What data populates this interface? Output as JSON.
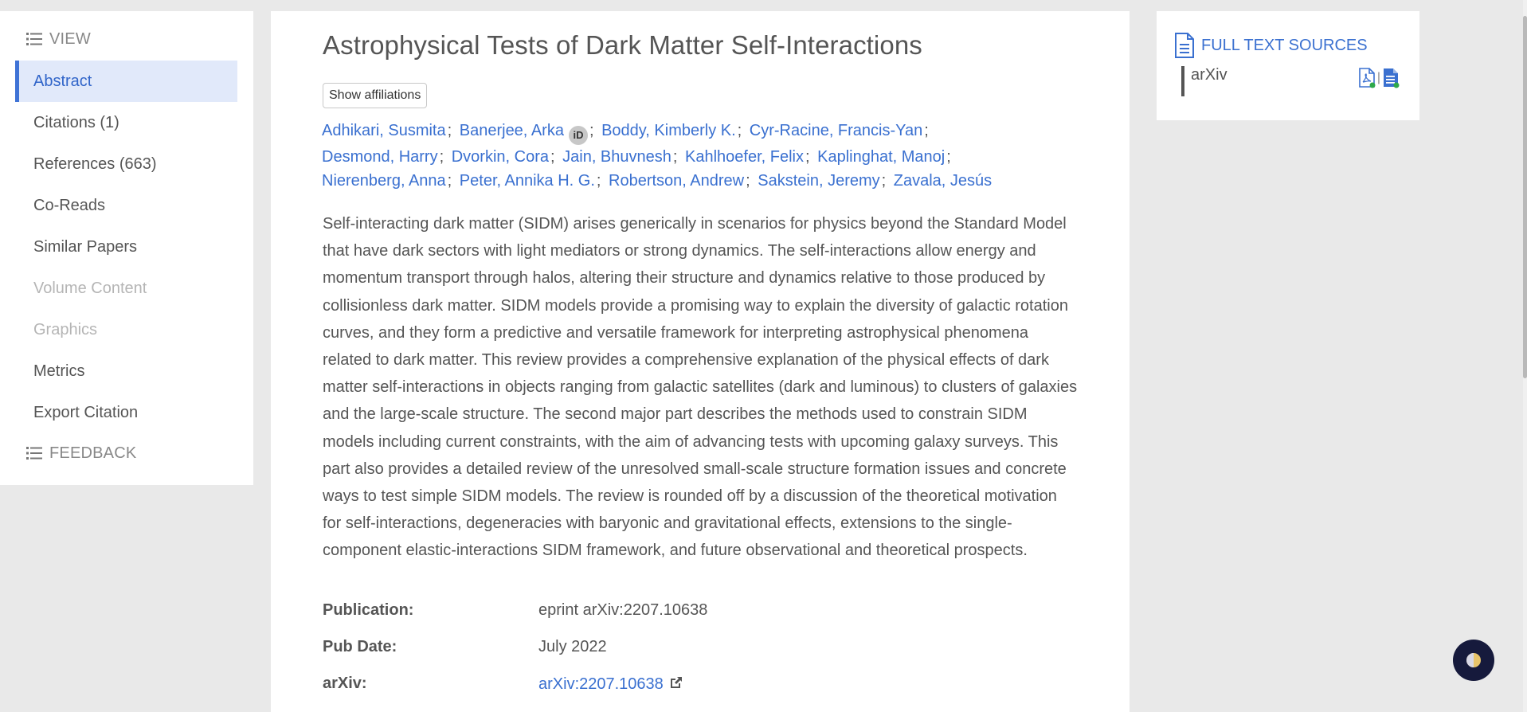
{
  "sidebar": {
    "view_label": "VIEW",
    "items": [
      {
        "label": "Abstract"
      },
      {
        "label": "Citations (1)"
      },
      {
        "label": "References (663)"
      },
      {
        "label": "Co-Reads"
      },
      {
        "label": "Similar Papers"
      },
      {
        "label": "Volume Content"
      },
      {
        "label": "Graphics"
      },
      {
        "label": "Metrics"
      },
      {
        "label": "Export Citation"
      }
    ],
    "feedback_label": "FEEDBACK"
  },
  "paper": {
    "title": "Astrophysical Tests of Dark Matter Self-Interactions",
    "show_affiliations": "Show affiliations",
    "authors": [
      "Adhikari, Susmita",
      "Banerjee, Arka",
      "Boddy, Kimberly K.",
      "Cyr-Racine, Francis-Yan",
      "Desmond, Harry",
      "Dvorkin, Cora",
      "Jain, Bhuvnesh",
      "Kahlhoefer, Felix",
      "Kaplinghat, Manoj",
      "Nierenberg, Anna",
      "Peter, Annika H. G.",
      "Robertson, Andrew",
      "Sakstein, Jeremy",
      "Zavala, Jesús"
    ],
    "orcid_label": "iD",
    "separator": ";",
    "abstract": "Self-interacting dark matter (SIDM) arises generically in scenarios for physics beyond the Standard Model that have dark sectors with light mediators or strong dynamics. The self-interactions allow energy and momentum transport through halos, altering their structure and dynamics relative to those produced by collisionless dark matter. SIDM models provide a promising way to explain the diversity of galactic rotation curves, and they form a predictive and versatile framework for interpreting astrophysical phenomena related to dark matter. This review provides a comprehensive explanation of the physical effects of dark matter self-interactions in objects ranging from galactic satellites (dark and luminous) to clusters of galaxies and the large-scale structure. The second major part describes the methods used to constrain SIDM models including current constraints, with the aim of advancing tests with upcoming galaxy surveys. This part also provides a detailed review of the unresolved small-scale structure formation issues and concrete ways to test simple SIDM models. The review is rounded off by a discussion of the theoretical motivation for self-interactions, degeneracies with baryonic and gravitational effects, extensions to the single-component elastic-interactions SIDM framework, and future observational and theoretical prospects.",
    "meta": {
      "publication_label": "Publication:",
      "publication_value": "eprint arXiv:2207.10638",
      "pubdate_label": "Pub Date:",
      "pubdate_value": "July 2022",
      "arxiv_label": "arXiv:",
      "arxiv_value": "arXiv:2207.10638"
    }
  },
  "full_text": {
    "title": "FULL TEXT SOURCES",
    "source": "arXiv",
    "pipe": "|",
    "icons": [
      "pdf-icon",
      "html-document-icon"
    ]
  },
  "colors": {
    "accent": "#3a70d0",
    "active_bg": "#e1e9fa",
    "theme_button": "#161a3c",
    "status_dot": "#2ea84a"
  }
}
